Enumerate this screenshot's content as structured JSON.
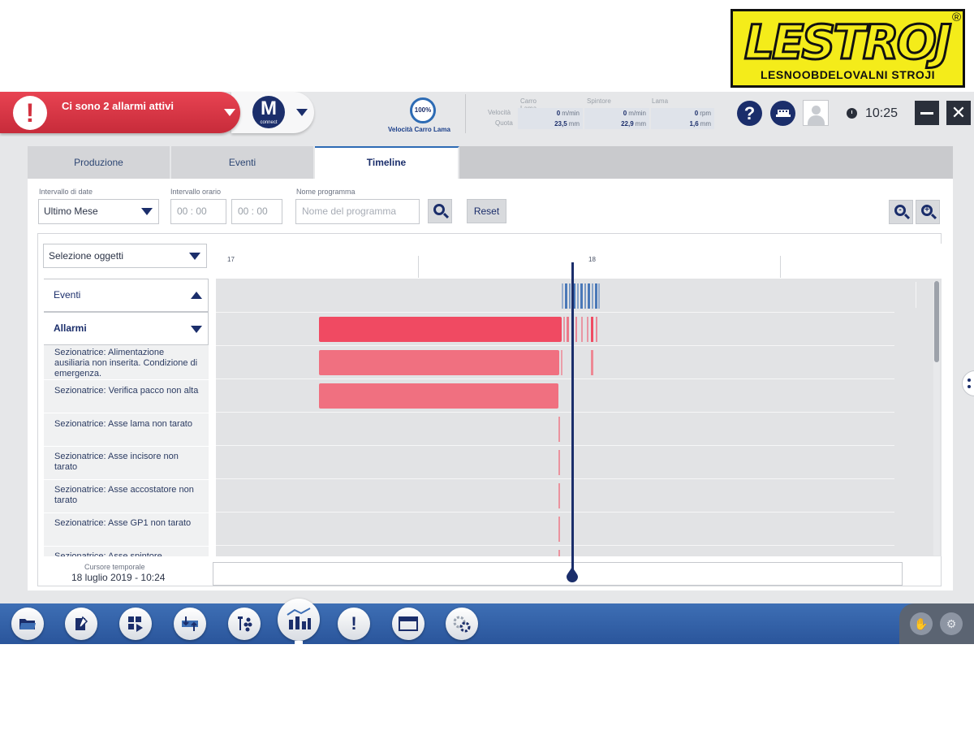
{
  "logo": {
    "word": "LESTROJ",
    "subtitle": "LESNOOBDELOVALNI STROJI",
    "reg": "®"
  },
  "header": {
    "alarm_text": "Ci sono 2 allarmi attivi",
    "mconnect": {
      "letter": "M",
      "sub": "connect"
    },
    "speed": {
      "percent": "100%",
      "label": "Velocità Carro Lama"
    },
    "measures": {
      "columns": [
        "Carro Lama",
        "Spintore",
        "Lama"
      ],
      "row_labels": [
        "Velocità",
        "Quota"
      ],
      "velocity": [
        {
          "v": "0",
          "u": "m/min"
        },
        {
          "v": "0",
          "u": "m/min"
        },
        {
          "v": "0",
          "u": "rpm"
        }
      ],
      "quota": [
        {
          "v": "23,5",
          "u": "mm"
        },
        {
          "v": "22,9",
          "u": "mm"
        },
        {
          "v": "1,6",
          "u": "mm"
        }
      ]
    },
    "help": "?",
    "time": "10:25"
  },
  "tabs": [
    "Produzione",
    "Eventi",
    "Timeline"
  ],
  "filters": {
    "date_label": "Intervallo di date",
    "date_value": "Ultimo Mese",
    "time_label": "Intervallo orario",
    "time_from": "00 : 00",
    "time_to": "00 : 00",
    "program_label": "Nome programma",
    "program_placeholder": "Nome del programma",
    "reset": "Reset"
  },
  "timeline": {
    "objects_select": "Selezione oggetti",
    "group_events": "Eventi",
    "group_alarms": "Allarmi",
    "alarms": [
      "Sezionatrice: Alimentazione ausiliaria non inserita. Condizione di emergenza.",
      "Sezionatrice: Verifica pacco non alta",
      "Sezionatrice: Asse lama non tarato",
      "Sezionatrice: Asse incisore non tarato",
      "Sezionatrice: Asse accostatore non tarato",
      "Sezionatrice: Asse GP1 non tarato",
      "Sezionatrice: Asse spintore"
    ],
    "ticks": [
      "17",
      "18"
    ],
    "cursor_label": "Cursore temporale",
    "cursor_value": "18 luglio 2019 - 10:24"
  },
  "toolbar": {
    "items": [
      "folder-icon",
      "edit-icon",
      "program-icon",
      "transfer-icon",
      "tools-icon",
      "statistics-icon",
      "alarm-icon",
      "window-icon",
      "settings-icon"
    ],
    "alarm_symbol": "!"
  },
  "colors": {
    "navy": "#1b2e6b",
    "alarm_red": "#d3313f",
    "bar_red": "#f04a62",
    "bar_pink": "#f07080",
    "event_blue": "#4a78b8"
  }
}
